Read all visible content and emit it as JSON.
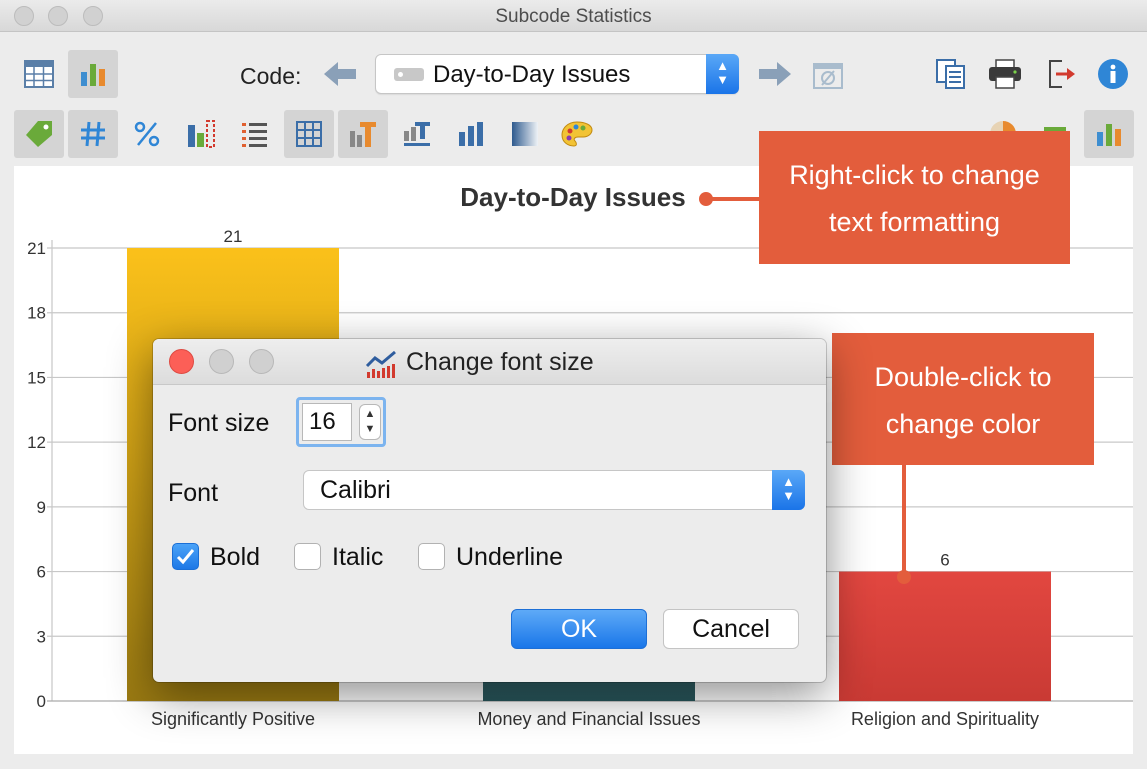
{
  "window": {
    "title": "Subcode Statistics"
  },
  "toolbar": {
    "code_label": "Code:",
    "code_value": "Day-to-Day Issues"
  },
  "dialog": {
    "title": "Change font size",
    "font_size_label": "Font size",
    "font_size_value": "16",
    "font_label": "Font",
    "font_value": "Calibri",
    "bold_label": "Bold",
    "bold_checked": true,
    "italic_label": "Italic",
    "italic_checked": false,
    "underline_label": "Underline",
    "underline_checked": false,
    "ok_label": "OK",
    "cancel_label": "Cancel"
  },
  "callouts": {
    "right_click_line1": "Right-click to change",
    "right_click_line2": "text formatting",
    "double_click_line1": "Double-click to",
    "double_click_line2": "change color"
  },
  "colors": {
    "accent_blue": "#1976e9",
    "callout": "#e35d3c",
    "bar_yellow": "#f2b70a",
    "bar_teal": "#2e5e63",
    "bar_red": "#d9423b"
  },
  "chart_data": {
    "type": "bar",
    "title": "Day-to-Day Issues",
    "categories": [
      "Significantly Positive",
      "Money and Financial Issues",
      "Religion and Spirituality"
    ],
    "values": [
      21,
      2,
      6
    ],
    "value_labels": [
      "21",
      "",
      "6"
    ],
    "ylim": [
      0,
      21
    ],
    "yticks": [
      0,
      3,
      6,
      9,
      12,
      15,
      18,
      21
    ],
    "grid": true,
    "colors": [
      "#f2b70a",
      "#2e5e63",
      "#d9423b"
    ]
  }
}
